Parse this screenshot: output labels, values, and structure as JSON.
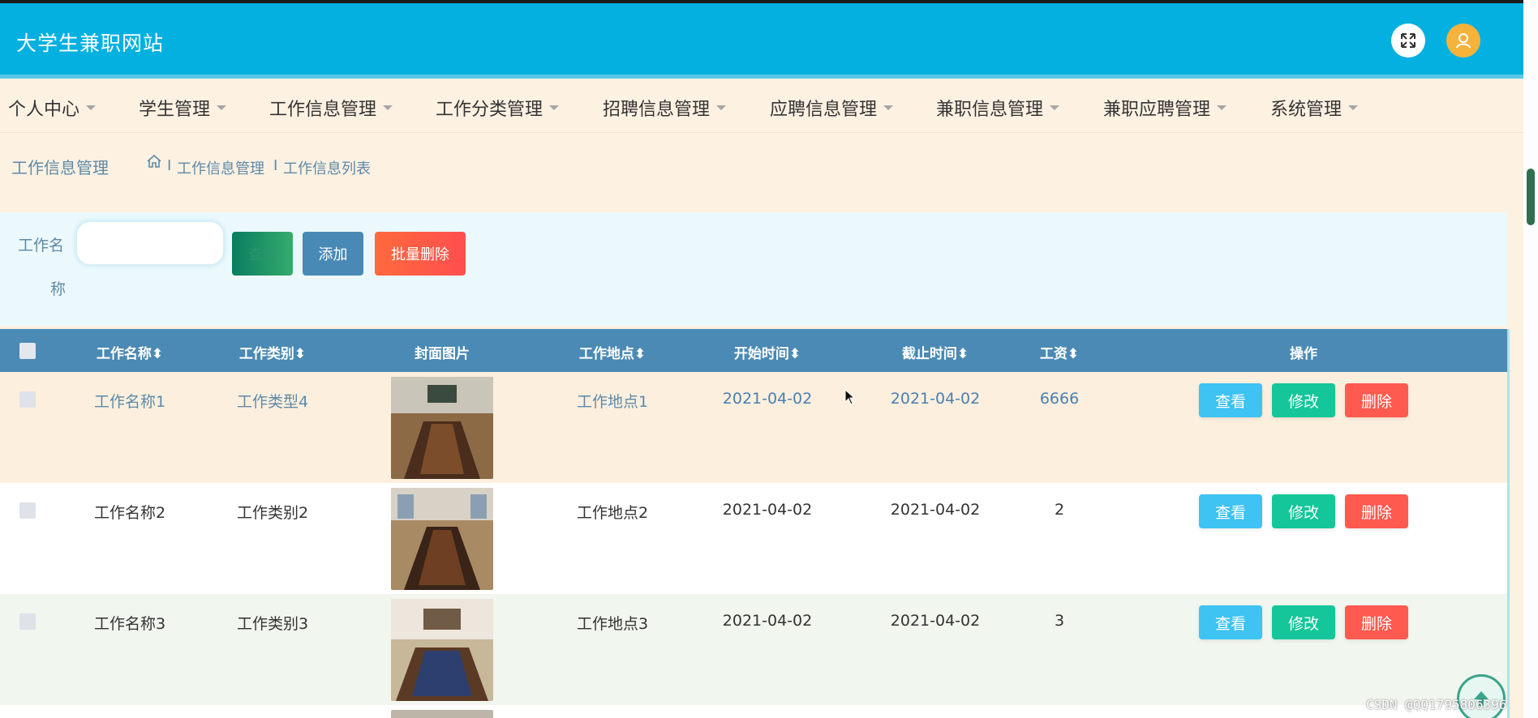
{
  "header": {
    "site_title": "大学生兼职网站",
    "fullscreen_icon": "expand-icon",
    "user_icon": "user-icon",
    "accent_color": "#03b0e0"
  },
  "nav": {
    "items": [
      {
        "label": "个人中心"
      },
      {
        "label": "学生管理"
      },
      {
        "label": "工作信息管理"
      },
      {
        "label": "工作分类管理"
      },
      {
        "label": "招聘信息管理"
      },
      {
        "label": "应聘信息管理"
      },
      {
        "label": "兼职信息管理"
      },
      {
        "label": "兼职应聘管理"
      },
      {
        "label": "系统管理"
      }
    ]
  },
  "breadcrumb": {
    "page_title": "工作信息管理",
    "home_icon": "home-icon",
    "separator": "I",
    "level1": "工作信息管理",
    "level2": "工作信息列表"
  },
  "search": {
    "label_line1": "工作名",
    "label_line2": "称",
    "input_value": "",
    "query_label": "查询",
    "add_label": "添加",
    "batch_delete_label": "批量删除"
  },
  "table": {
    "headers": {
      "name": "工作名称",
      "category": "工作类别",
      "cover": "封面图片",
      "location": "工作地点",
      "start": "开始时间",
      "end": "截止时间",
      "salary": "工资",
      "actions": "操作"
    },
    "rows": [
      {
        "name": "工作名称1",
        "category": "工作类型4",
        "location": "工作地点1",
        "start": "2021-04-02",
        "end": "2021-04-02",
        "salary": "6666",
        "highlighted": true
      },
      {
        "name": "工作名称2",
        "category": "工作类别2",
        "location": "工作地点2",
        "start": "2021-04-02",
        "end": "2021-04-02",
        "salary": "2",
        "highlighted": false
      },
      {
        "name": "工作名称3",
        "category": "工作类别3",
        "location": "工作地点3",
        "start": "2021-04-02",
        "end": "2021-04-02",
        "salary": "3",
        "highlighted": false
      }
    ],
    "action_labels": {
      "view": "查看",
      "edit": "修改",
      "delete": "删除"
    }
  },
  "scroll_top_icon": "arrow-up-icon",
  "watermark": "CSDN @QQ1795806396"
}
